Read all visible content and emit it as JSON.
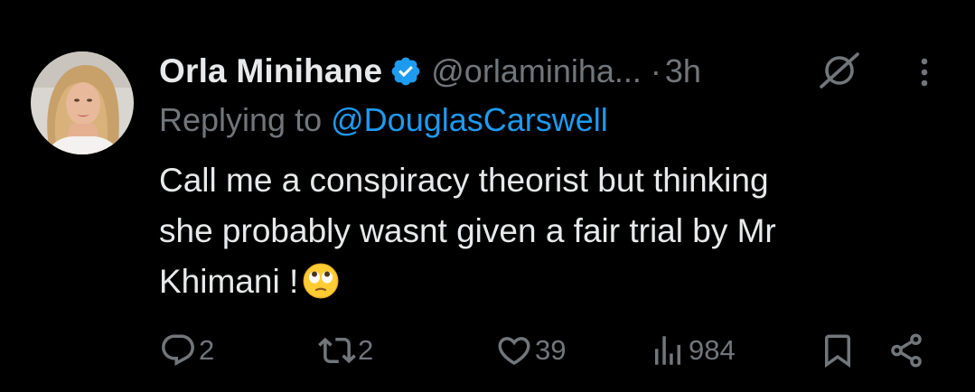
{
  "tweet": {
    "author_name": "Orla Minihane",
    "handle": "@orlaminiha...",
    "separator": "·",
    "time": "3h",
    "replying_prefix": "Replying to",
    "replying_to": "@DouglasCarswell",
    "text_lines": [
      "Call me a conspiracy theorist but thinking",
      "she probably wasnt given a fair trial by Mr",
      "Khimani !"
    ],
    "emoji": "face-with-rolling-eyes"
  },
  "actions": {
    "replies": "2",
    "reposts": "2",
    "likes": "39",
    "views": "984"
  },
  "colors": {
    "background": "#000000",
    "primary_text": "#e7e9ea",
    "secondary_text": "#71767b",
    "accent": "#1d9bf0"
  },
  "icons": [
    "verified-badge-icon",
    "grok-icon",
    "more-icon",
    "reply-icon",
    "repost-icon",
    "like-icon",
    "views-icon",
    "bookmark-icon",
    "share-icon"
  ]
}
